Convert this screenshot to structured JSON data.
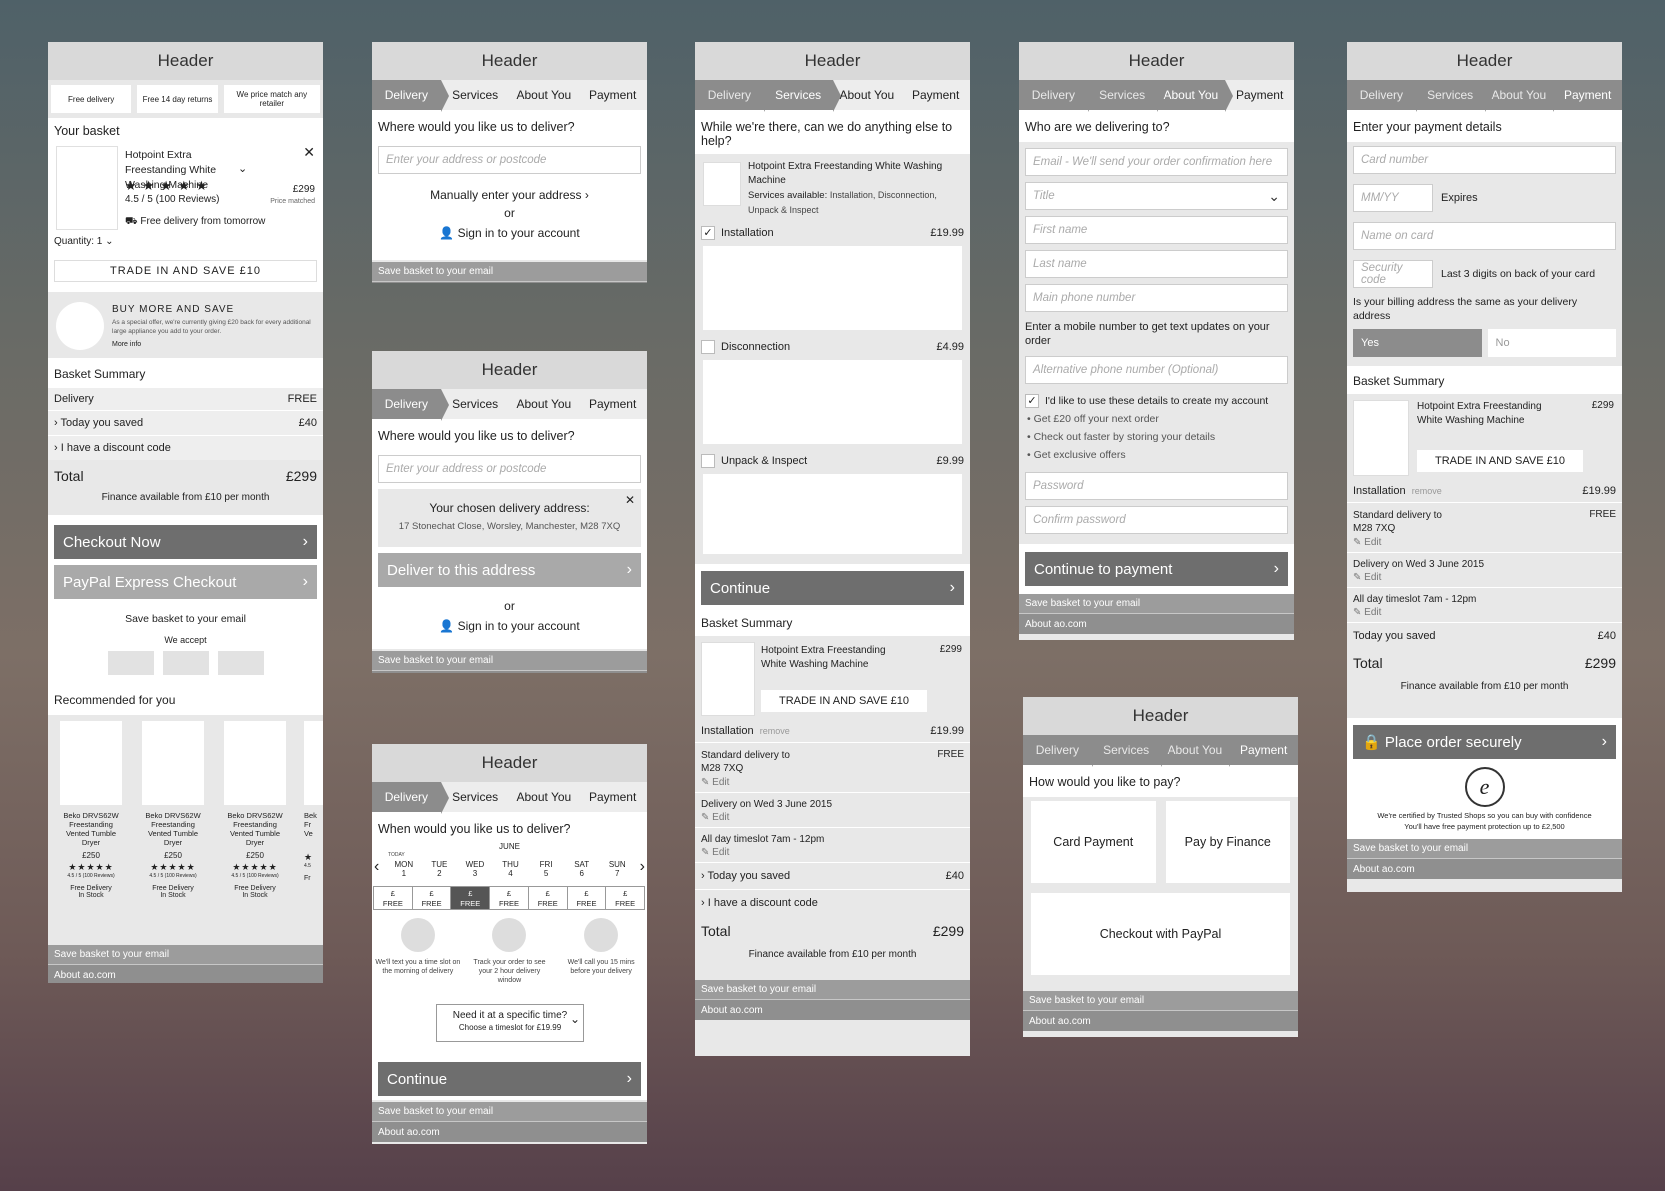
{
  "common": {
    "header": "Header",
    "save_basket": "Save basket to your email",
    "about": "About ao.com",
    "steps": [
      "Delivery",
      "Services",
      "About You",
      "Payment"
    ]
  },
  "s1": {
    "usps": [
      "Free delivery",
      "Free 14 day returns",
      "We price match any retailer"
    ],
    "basket_title": "Your basket",
    "product": "Hotpoint Extra Freestanding White Washing Machine",
    "rating": "4.5 / 5 (100 Reviews)",
    "price": "£299",
    "price_matched": "Price matched",
    "delivery": "Free delivery from tomorrow",
    "quantity": "Quantity: 1",
    "trade": "TRADE IN AND SAVE £10",
    "buy_more_title": "BUY MORE AND SAVE",
    "buy_more_text": "As a special offer, we're currently giving £20 back for every additional large appliance you add to your order.",
    "more_info": "More info",
    "summary_title": "Basket Summary",
    "delivery_label": "Delivery",
    "delivery_value": "FREE",
    "saved_label": "Today you saved",
    "saved_value": "£40",
    "discount": "I have a discount code",
    "total_label": "Total",
    "total_value": "£299",
    "finance": "Finance available from £10 per month",
    "checkout": "Checkout Now",
    "paypal": "PayPal Express Checkout",
    "save_email": "Save basket to your email",
    "we_accept": "We accept",
    "recommended": "Recommended for you",
    "rec_items": [
      {
        "name": "Beko DRVS62W Freestanding Vented Tumble Dryer",
        "price": "£250",
        "reviews": "4.5 / 5 (100 Reviews)",
        "delivery": "Free Delivery",
        "stock": "In Stock"
      },
      {
        "name": "Beko DRVS62W Freestanding Vented Tumble Dryer",
        "price": "£250",
        "reviews": "4.5 / 5 (100 Reviews)",
        "delivery": "Free Delivery",
        "stock": "In Stock"
      },
      {
        "name": "Beko DRVS62W Freestanding Vented Tumble Dryer",
        "price": "£250",
        "reviews": "4.5 / 5 (100 Reviews)",
        "delivery": "Free Delivery",
        "stock": "In Stock"
      }
    ],
    "rec_partial": {
      "name": "Bek Fr Ve",
      "reviews": "4.5",
      "delivery": "Fr"
    }
  },
  "s2": {
    "question": "Where would you like us to deliver?",
    "placeholder": "Enter your address or postcode",
    "manual": "Manually enter your address",
    "or": "or",
    "signin": "Sign in to your account"
  },
  "s3": {
    "question": "Where would you like us to deliver?",
    "placeholder": "Enter your address or postcode",
    "chosen_title": "Your chosen delivery address:",
    "chosen_address": "17 Stonechat Close, Worsley, Manchester, M28 7XQ",
    "deliver_btn": "Deliver to this address",
    "or": "or",
    "signin": "Sign in to your account"
  },
  "s4": {
    "question": "When would you like us to deliver?",
    "month": "JUNE",
    "today": "TODAY",
    "days": [
      {
        "d": "MON",
        "n": "1"
      },
      {
        "d": "TUE",
        "n": "2"
      },
      {
        "d": "WED",
        "n": "3"
      },
      {
        "d": "THU",
        "n": "4"
      },
      {
        "d": "FRI",
        "n": "5"
      },
      {
        "d": "SAT",
        "n": "6"
      },
      {
        "d": "SUN",
        "n": "7"
      }
    ],
    "price_sym": "£",
    "free": "FREE",
    "features": [
      "We'll text you a time slot on the morning of delivery",
      "Track your order to see your 2 hour delivery window",
      "We'll call you 15 mins before your delivery"
    ],
    "specific_title": "Need it at a specific time?",
    "specific_sub": "Choose a timeslot for £19.99",
    "continue": "Continue"
  },
  "s5": {
    "question": "While we're there, can we do anything else to help?",
    "product": "Hotpoint Extra Freestanding White Washing Machine",
    "services_label": "Services available:",
    "services": "Installation, Disconnection, Unpack & Inspect",
    "options": [
      {
        "name": "Installation",
        "price": "£19.99"
      },
      {
        "name": "Disconnection",
        "price": "£4.99"
      },
      {
        "name": "Unpack & Inspect",
        "price": "£9.99"
      }
    ],
    "continue": "Continue",
    "summary_title": "Basket Summary",
    "summary_product": "Hotpoint Extra Freestanding White Washing Machine",
    "summary_price": "£299",
    "trade": "TRADE IN AND SAVE £10",
    "installation": "Installation",
    "remove": "remove",
    "installation_price": "£19.99",
    "std_delivery": "Standard delivery to M28 7XQ",
    "free": "FREE",
    "edit": "Edit",
    "delivery_date": "Delivery on Wed 3 June 2015",
    "timeslot": "All day timeslot 7am - 12pm",
    "saved_label": "Today you saved",
    "saved_value": "£40",
    "discount": "I have a discount code",
    "total_label": "Total",
    "total_value": "£299",
    "finance": "Finance available from £10 per month"
  },
  "s6": {
    "question": "Who are we delivering to?",
    "email_ph": "Email - We'll send your order confirmation here",
    "title_ph": "Title",
    "first_ph": "First name",
    "last_ph": "Last name",
    "phone_ph": "Main phone number",
    "mobile_note": "Enter a mobile number to get text updates on your order",
    "alt_ph": "Alternative phone number (Optional)",
    "create_account": "I'd like to use these details to create my account",
    "benefits": [
      "Get £20 off your next order",
      "Check out faster by storing your details",
      "Get exclusive offers"
    ],
    "password_ph": "Password",
    "confirm_ph": "Confirm password",
    "continue": "Continue to payment"
  },
  "s7": {
    "question": "How would you like to pay?",
    "card": "Card Payment",
    "finance": "Pay by Finance",
    "paypal": "Checkout with PayPal"
  },
  "s8": {
    "question": "Enter your payment details",
    "card_ph": "Card number",
    "mmyy_ph": "MM/YY",
    "expires": "Expires",
    "name_ph": "Name on card",
    "cvv_ph": "Security code",
    "cvv_note": "Last 3 digits on back of your card",
    "billing_q": "Is your billing address the same as your delivery address",
    "yes": "Yes",
    "no": "No",
    "summary_title": "Basket Summary",
    "product": "Hotpoint Extra Freestanding White Washing Machine",
    "price": "£299",
    "trade": "TRADE IN AND SAVE £10",
    "installation": "Installation",
    "remove": "remove",
    "installation_price": "£19.99",
    "std_delivery": "Standard delivery to M28 7XQ",
    "free": "FREE",
    "edit": "Edit",
    "delivery_date": "Delivery on Wed 3 June 2015",
    "timeslot": "All day timeslot 7am - 12pm",
    "saved_label": "Today you saved",
    "saved_value": "£40",
    "total_label": "Total",
    "total_value": "£299",
    "finance": "Finance available from £10 per month",
    "place_order": "Place order securely",
    "certified": "We're certified by Trusted Shops so you can buy with confidence",
    "protection": "You'll have free payment protection up to £2,500",
    "badge_letter": "e"
  }
}
